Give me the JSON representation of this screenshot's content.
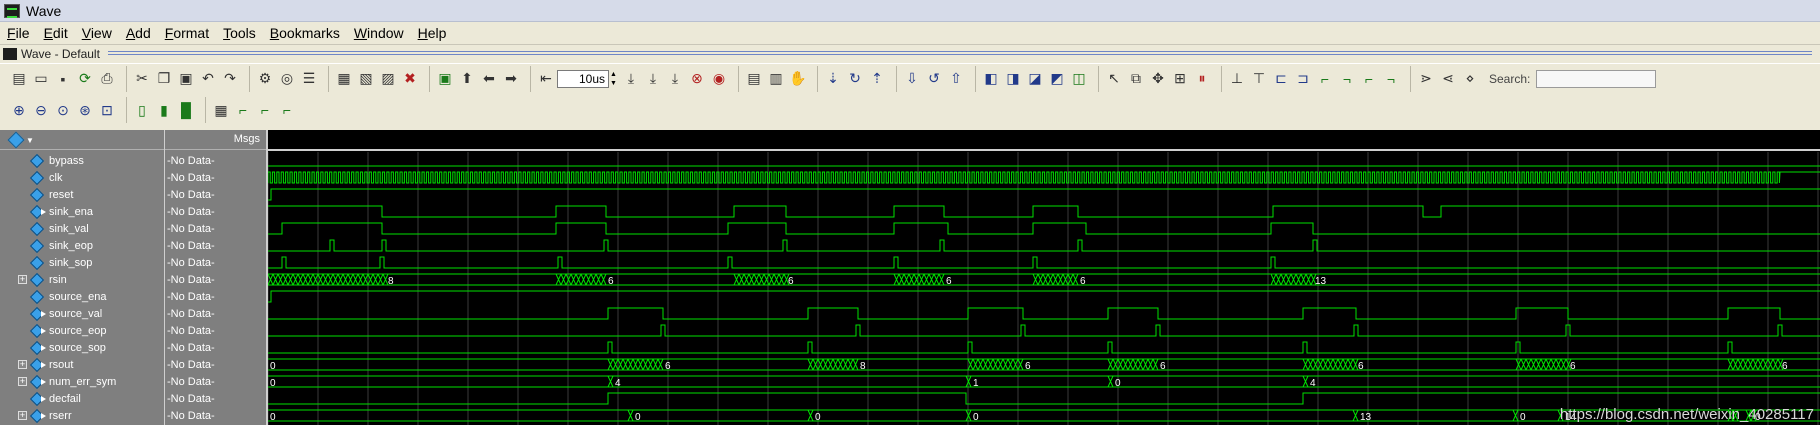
{
  "window": {
    "title": "Wave"
  },
  "menu": [
    {
      "label": "File",
      "key": "F",
      "rest": "ile"
    },
    {
      "label": "Edit",
      "key": "E",
      "rest": "dit"
    },
    {
      "label": "View",
      "key": "V",
      "rest": "iew"
    },
    {
      "label": "Add",
      "key": "A",
      "rest": "dd"
    },
    {
      "label": "Format",
      "key": "F",
      "rest": "ormat"
    },
    {
      "label": "Tools",
      "key": "T",
      "rest": "ools"
    },
    {
      "label": "Bookmarks",
      "key": "B",
      "rest": "ookmarks"
    },
    {
      "label": "Window",
      "key": "W",
      "rest": "indow"
    },
    {
      "label": "Help",
      "key": "H",
      "rest": "elp"
    }
  ],
  "panel": {
    "title": "Wave - Default"
  },
  "toolbar": {
    "time_value": "10us",
    "search_label": "Search:",
    "search_value": ""
  },
  "columns": {
    "msgs_header": "Msgs"
  },
  "signals": [
    {
      "name": "bypass",
      "value": "-No Data-",
      "expandable": false,
      "direction": "in"
    },
    {
      "name": "clk",
      "value": "-No Data-",
      "expandable": false,
      "direction": "in"
    },
    {
      "name": "reset",
      "value": "-No Data-",
      "expandable": false,
      "direction": "in"
    },
    {
      "name": "sink_ena",
      "value": "-No Data-",
      "expandable": false,
      "direction": "out"
    },
    {
      "name": "sink_val",
      "value": "-No Data-",
      "expandable": false,
      "direction": "in"
    },
    {
      "name": "sink_eop",
      "value": "-No Data-",
      "expandable": false,
      "direction": "in"
    },
    {
      "name": "sink_sop",
      "value": "-No Data-",
      "expandable": false,
      "direction": "in"
    },
    {
      "name": "rsin",
      "value": "-No Data-",
      "expandable": true,
      "direction": "in"
    },
    {
      "name": "source_ena",
      "value": "-No Data-",
      "expandable": false,
      "direction": "in"
    },
    {
      "name": "source_val",
      "value": "-No Data-",
      "expandable": false,
      "direction": "out"
    },
    {
      "name": "source_eop",
      "value": "-No Data-",
      "expandable": false,
      "direction": "out"
    },
    {
      "name": "source_sop",
      "value": "-No Data-",
      "expandable": false,
      "direction": "out"
    },
    {
      "name": "rsout",
      "value": "-No Data-",
      "expandable": true,
      "direction": "out"
    },
    {
      "name": "num_err_sym",
      "value": "-No Data-",
      "expandable": true,
      "direction": "out"
    },
    {
      "name": "decfail",
      "value": "-No Data-",
      "expandable": false,
      "direction": "out"
    },
    {
      "name": "rserr",
      "value": "-No Data-",
      "expandable": true,
      "direction": "out"
    }
  ],
  "bus_labels": {
    "rsin": [
      "8",
      "6",
      "6",
      "6",
      "6",
      "13"
    ],
    "rsout": [
      "0",
      "6",
      "8",
      "6",
      "6",
      "6",
      "6",
      "6"
    ],
    "num_err_sym": [
      "0",
      "4",
      "1",
      "0",
      "4"
    ],
    "rserr": [
      "0",
      "0",
      "0",
      "0",
      "13",
      "0",
      "14",
      "0"
    ]
  },
  "colors": {
    "wave": "#00e000",
    "grid": "#3a3a3a",
    "background": "#000000",
    "panel": "#7f7f7f"
  },
  "watermark": "https://blog.csdn.net/weixin_40285117"
}
